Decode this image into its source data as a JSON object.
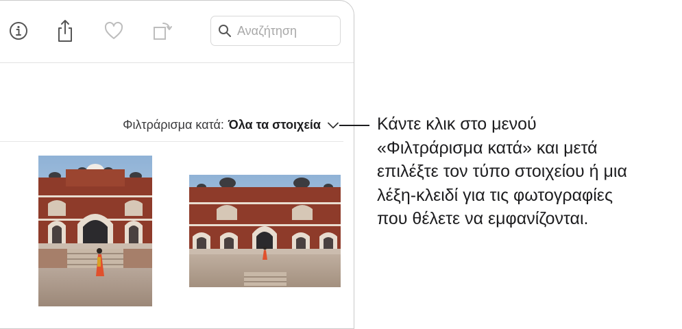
{
  "toolbar": {
    "info_icon": "info-circle-icon",
    "share_icon": "share-icon",
    "favorite_icon": "heart-icon",
    "rotate_icon": "rotate-icon",
    "search": {
      "placeholder": "Αναζήτηση",
      "icon": "magnifier-icon"
    }
  },
  "filter": {
    "label": "Φιλτράρισμα κατά:",
    "value": "Όλα τα στοιχεία",
    "icon": "chevron-down-icon"
  },
  "photos": [
    {
      "subject": "Humayun's Tomb portrait photo",
      "orientation": "portrait"
    },
    {
      "subject": "Humayun's Tomb landscape photo",
      "orientation": "landscape"
    }
  ],
  "callout": {
    "lines": [
      "Κάντε κλικ στο μενού",
      "«Φιλτράρισμα κατά» και μετά",
      "επιλέξτε τον τύπο στοιχείου ή μια",
      "λέξη-κλειδί για τις φωτογραφίες",
      "που θέλετε να εμφανίζονται."
    ]
  },
  "colors": {
    "text": "#1d1d1f",
    "icon": "#6e6e73",
    "border": "#c9c9c9"
  }
}
